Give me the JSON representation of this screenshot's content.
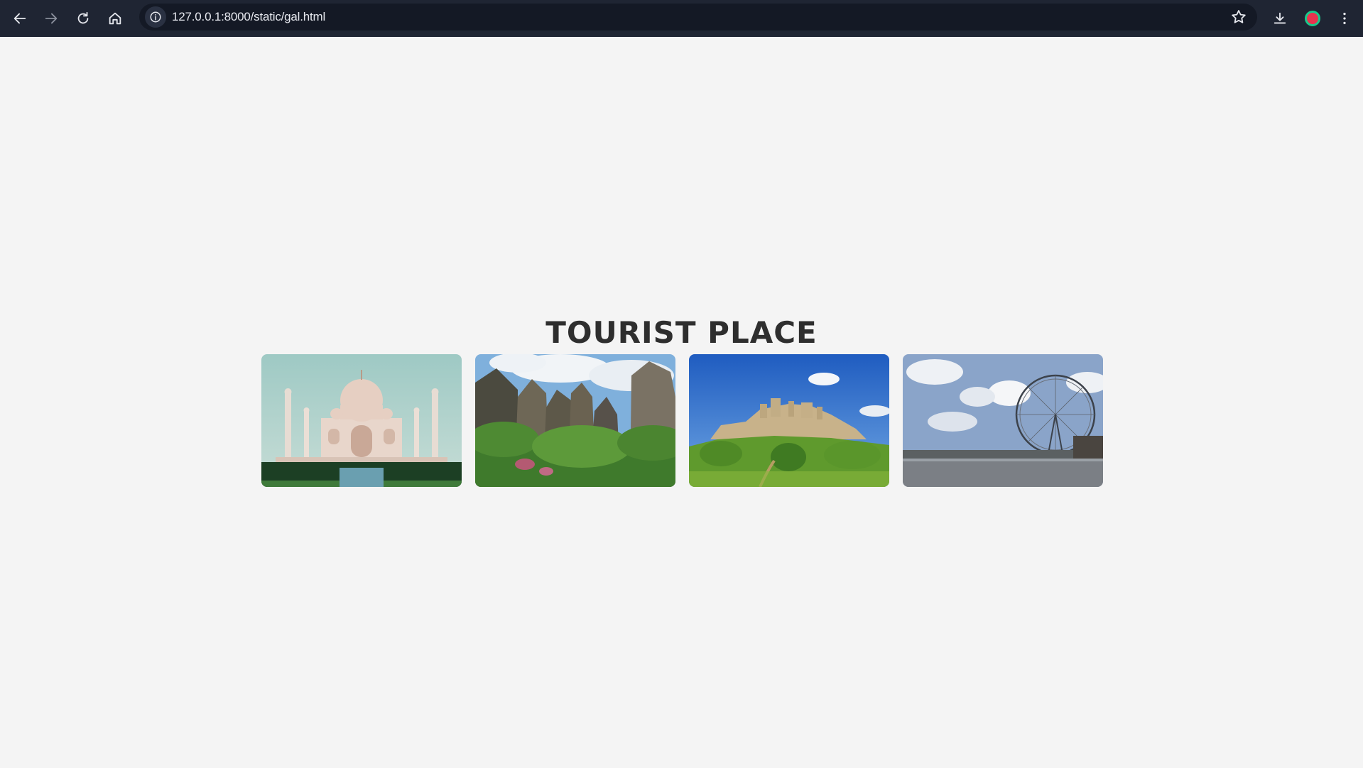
{
  "browser": {
    "url": "127.0.0.1:8000/static/gal.html",
    "icons": [
      "back-arrow-icon",
      "forward-arrow-icon",
      "reload-icon",
      "home-icon",
      "site-info-icon",
      "bookmark-star-icon",
      "download-icon",
      "profile-icon",
      "menu-kebab-icon"
    ],
    "colors": {
      "toolbar": "#1f2533",
      "omnibox": "#141925",
      "page_background": "#f4f4f4"
    }
  },
  "page": {
    "title": "TOURIST PLACE",
    "gallery": [
      {
        "subject": "Taj Mahal"
      },
      {
        "subject": "Rock pillars with greenery"
      },
      {
        "subject": "Castle ruins on hill"
      },
      {
        "subject": "London Eye and river"
      }
    ]
  }
}
